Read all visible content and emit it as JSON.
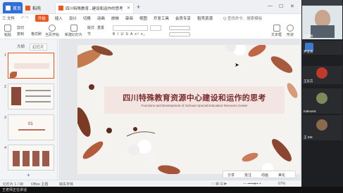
{
  "tabs": {
    "home": "首页",
    "doc": "稻壳",
    "active": "四川特殊教育...建设和运作的思考",
    "add": "+"
  },
  "menu": {
    "file": "三 文件",
    "start": "开始",
    "insert": "插入",
    "design": "设计",
    "switch": "切换",
    "animate": "动画",
    "show": "放映",
    "review": "审阅",
    "view": "视图",
    "tools": "开发工具",
    "member": "会员专享",
    "resource": "稻壳资源",
    "search": "Q 查找命令、搜索模板"
  },
  "toolbar": {
    "paste": "粘贴",
    "cut": "剪切",
    "copy": "复制",
    "format": "格式刷",
    "from_current": "当页开始",
    "new_slide": "新建幻灯片",
    "layout": "版式",
    "section": "节",
    "reset": "重置",
    "bold_row": "B I U S A x² x₂",
    "textbox": "文本框",
    "shape": "形状"
  },
  "left_panel": {
    "tab_outline": "大纲",
    "tab_slides": "幻灯片",
    "slide_numbers": [
      "1",
      "2",
      "3",
      "4"
    ],
    "thumb3_text": "01"
  },
  "slide": {
    "title_cn": "四川特殊教育资源中心建设和运作的思考",
    "title_en": "Functions and Development of Sichuan Special Education Resource Center"
  },
  "videos": [
    {
      "name": "王老师"
    },
    {
      "name": "尹老师"
    },
    {
      "name": "王东方"
    },
    {
      "name": "Indecent"
    },
    {
      "name": "王 EM"
    }
  ],
  "statusbar": {
    "slide_of": "幻灯片 1 / 38",
    "theme": "Office 主题",
    "font_missing": "缺失字体",
    "zoom": "67%"
  },
  "floatbar": {
    "share": "分享",
    "annotate": "批注",
    "animation": "动画",
    "beautify": "美化"
  },
  "bottombar": {
    "text": "王老师正在讲话"
  },
  "colors": {
    "accent": "#e9571f",
    "title": "#7a2c2c",
    "title_box": "#f3e6e2"
  }
}
